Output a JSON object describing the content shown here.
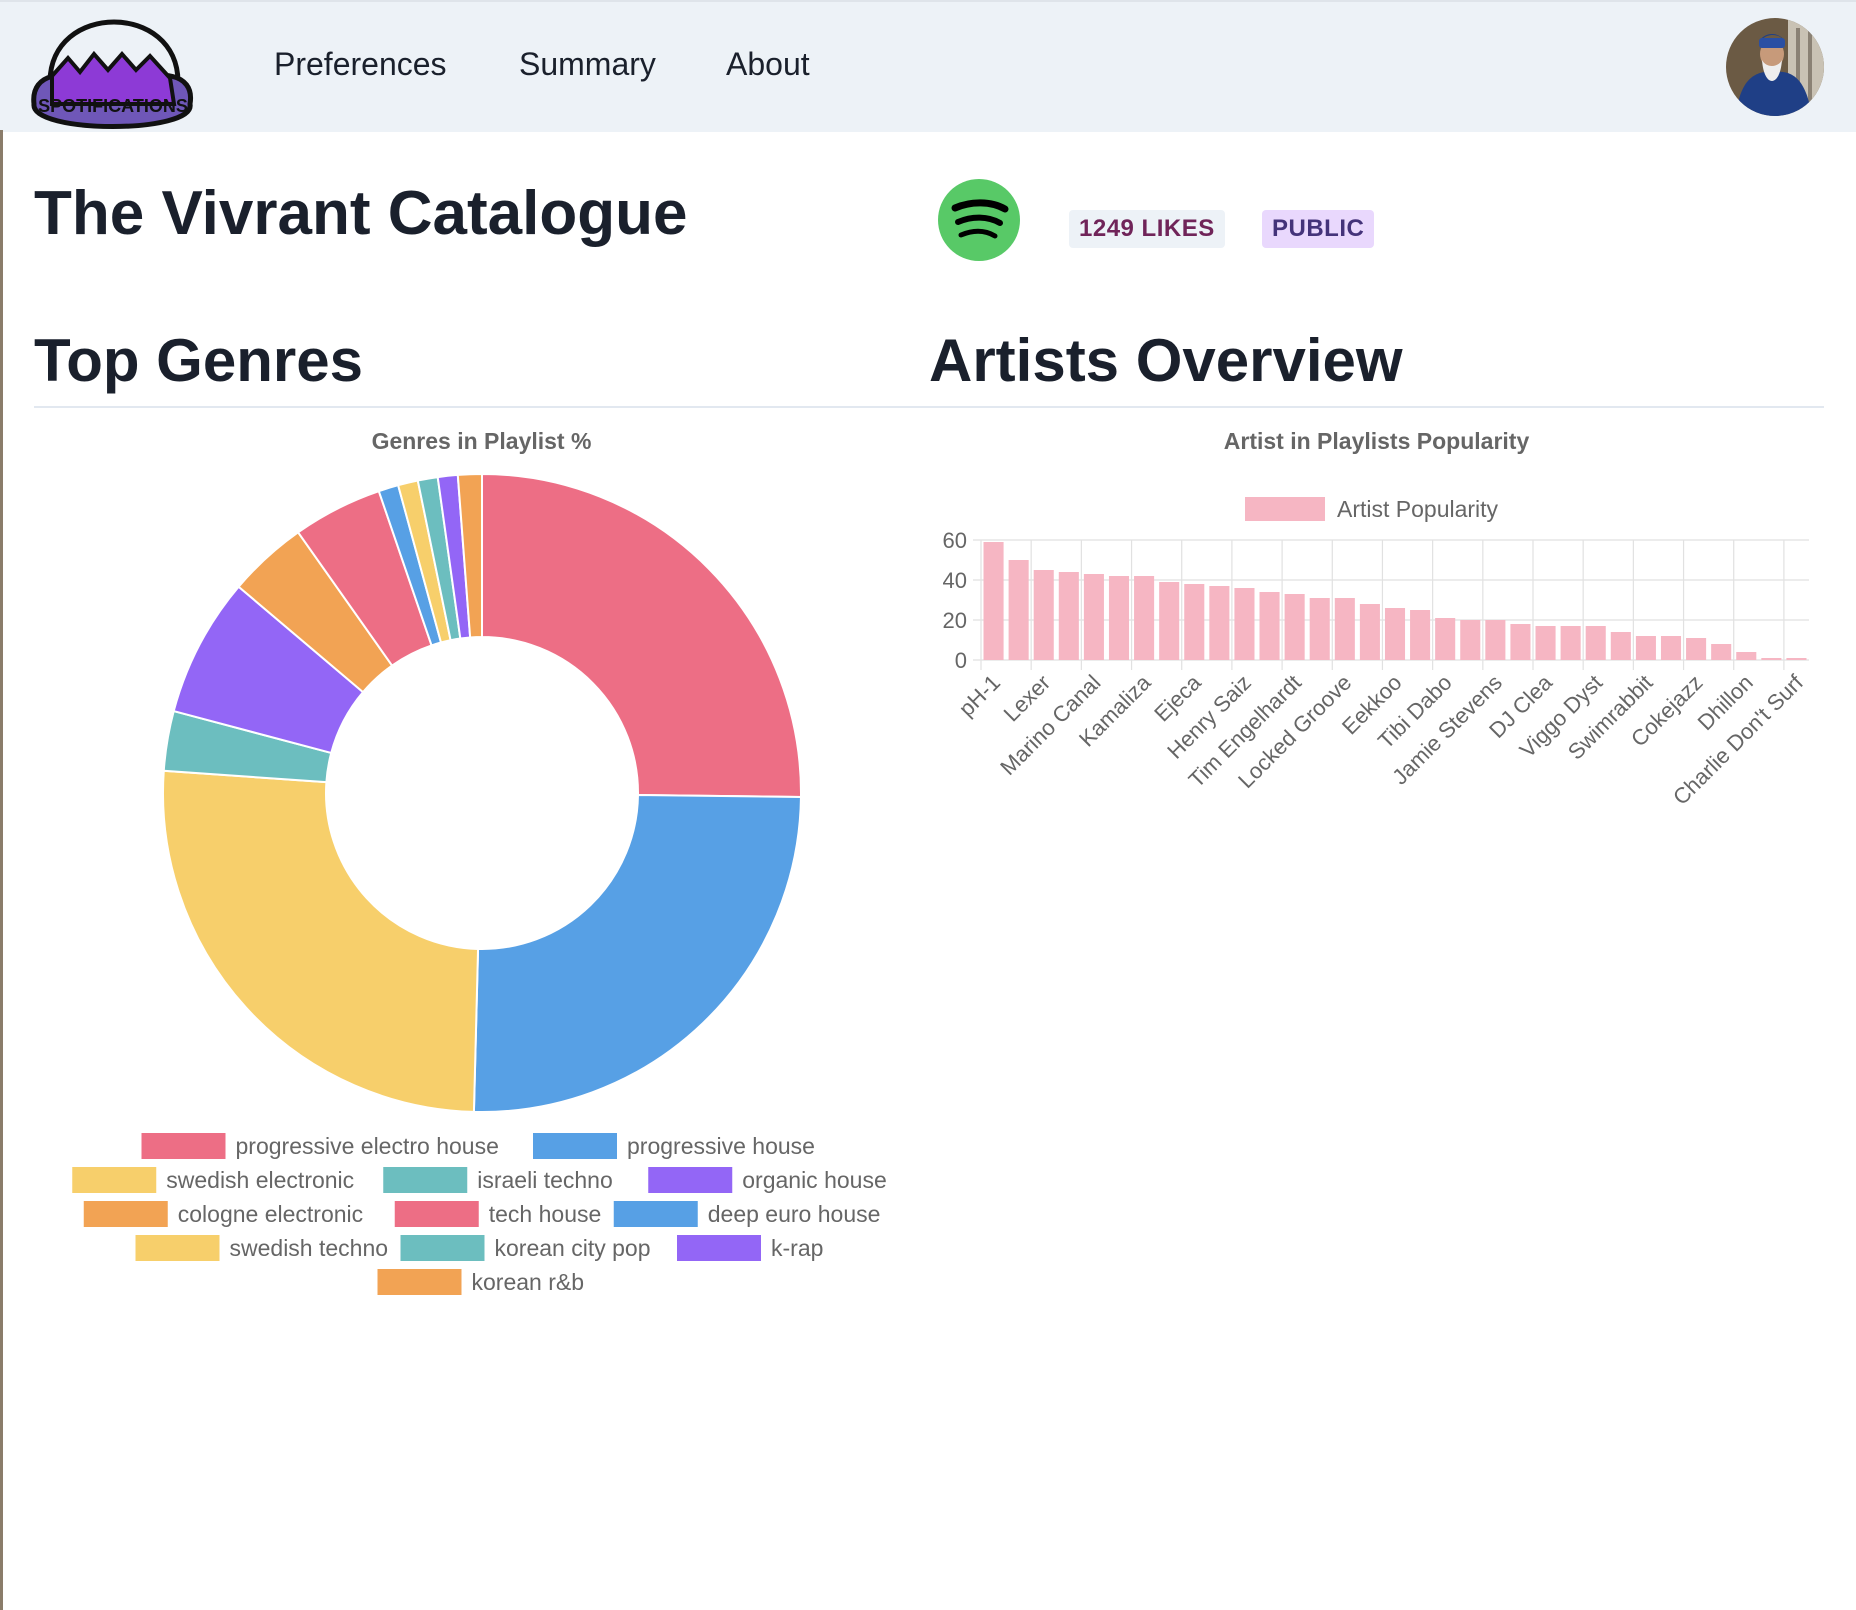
{
  "nav": {
    "logo_text": "SPOTIFICATIONS",
    "links": [
      "Preferences",
      "Summary",
      "About"
    ]
  },
  "playlist": {
    "title": "The Vivrant Catalogue",
    "likes_badge": "1249 LIKES",
    "visibility_badge": "PUBLIC"
  },
  "sections": {
    "genres_heading": "Top Genres",
    "artists_heading": "Artists Overview"
  },
  "colors": {
    "pink": "#ed6e85",
    "blue": "#57a0e5",
    "yellow": "#f7cf6b",
    "teal": "#6cbebf",
    "purple": "#9366f6",
    "orange": "#f2a354",
    "bar_pink": "#f6b6c3",
    "spotify_green": "#58c967"
  },
  "chart_data": [
    {
      "type": "pie",
      "title": "Genres in Playlist %",
      "labels": [
        "progressive electro house",
        "progressive house",
        "swedish electronic",
        "israeli techno",
        "organic house",
        "cologne electronic",
        "tech house",
        "deep euro house",
        "swedish techno",
        "korean city pop",
        "k-rap",
        "korean r&b"
      ],
      "values": [
        25,
        25,
        25.5,
        3,
        7,
        4,
        4.5,
        1,
        1,
        1,
        1,
        1.2
      ],
      "colors": [
        "#ed6e85",
        "#57a0e5",
        "#f7cf6b",
        "#6cbebf",
        "#9366f6",
        "#f2a354",
        "#ed6e85",
        "#57a0e5",
        "#f7cf6b",
        "#6cbebf",
        "#9366f6",
        "#f2a354"
      ],
      "legend_position": "bottom"
    },
    {
      "type": "bar",
      "title": "Artist in Playlists Popularity",
      "series": [
        {
          "name": "Artist Popularity",
          "values": [
            59,
            50,
            45,
            44,
            43,
            42,
            42,
            39,
            38,
            37,
            36,
            34,
            33,
            31,
            31,
            28,
            26,
            25,
            21,
            20,
            20,
            18,
            17,
            17,
            17,
            14,
            12,
            12,
            11,
            8,
            4,
            1,
            1
          ]
        }
      ],
      "category_labels": [
        "pH-1",
        "Lexer",
        "Marino Canal",
        "Kamaliza",
        "Ejeca",
        "Henry Saiz",
        "Tim Engelhardt",
        "Locked Groove",
        "Eekkoo",
        "Tibi Dabo",
        "Jamie Stevens",
        "DJ Clea",
        "Viggo Dyst",
        "Swimrabbit",
        "Cokejazz",
        "Dhillon",
        "Charlie Don't Surf"
      ],
      "y_ticks": [
        "0",
        "20",
        "40",
        "60"
      ],
      "ylim": [
        0,
        60
      ],
      "grid": true,
      "legend_position": "top"
    }
  ]
}
